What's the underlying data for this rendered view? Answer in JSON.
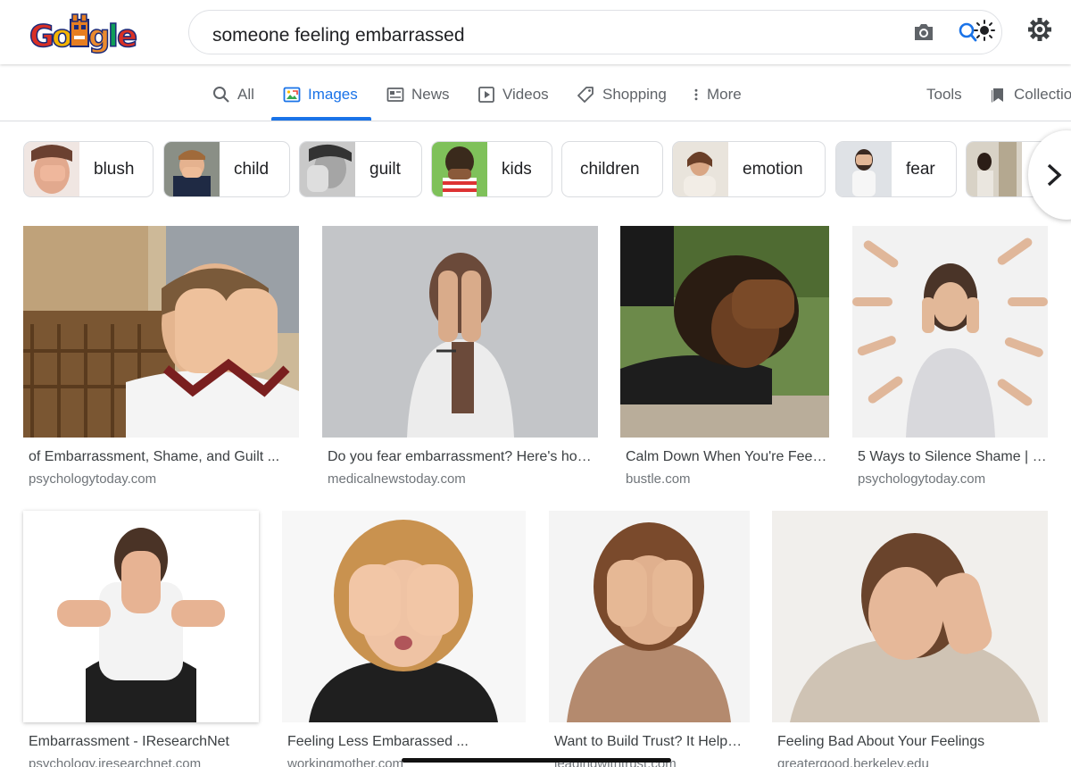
{
  "search": {
    "query": "someone feeling embarrassed"
  },
  "icons": {
    "logo": "google-doodle-logo",
    "camera": "camera-icon",
    "lens": "lens-search-icon",
    "settings": "gear-icon"
  },
  "tabs": [
    {
      "label": "All",
      "icon": "search-icon"
    },
    {
      "label": "Images",
      "icon": "image-icon",
      "active": true
    },
    {
      "label": "News",
      "icon": "news-icon"
    },
    {
      "label": "Videos",
      "icon": "video-icon"
    },
    {
      "label": "Shopping",
      "icon": "tag-icon"
    },
    {
      "label": "More",
      "icon": "dots-vertical-icon"
    }
  ],
  "tools": {
    "tools_label": "Tools",
    "collections_label": "Collections"
  },
  "chips": [
    {
      "label": "blush"
    },
    {
      "label": "child"
    },
    {
      "label": "guilt"
    },
    {
      "label": "kids"
    },
    {
      "label": "children"
    },
    {
      "label": "emotion"
    },
    {
      "label": "fear"
    }
  ],
  "results": [
    {
      "title": "of Embarrassment, Shame, and Guilt ...",
      "source": "psychologytoday.com"
    },
    {
      "title": "Do you fear embarrassment? Here's ho…",
      "source": "medicalnewstoday.com"
    },
    {
      "title": "Calm Down When You're Feel…",
      "source": "bustle.com"
    },
    {
      "title": "5 Ways to Silence Shame | …",
      "source": "psychologytoday.com"
    },
    {
      "title": "Embarrassment - IResearchNet",
      "source": "psychology.iresearchnet.com"
    },
    {
      "title": "Feeling Less Embarassed ...",
      "source": "workingmother.com"
    },
    {
      "title": "Want to Build Trust? It Help…",
      "source": "leadingwithtrust.com"
    },
    {
      "title": "Feeling Bad About Your Feelings",
      "source": "greatergood.berkeley.edu"
    }
  ],
  "colors": {
    "accent": "#1a73e8",
    "text": "#202124",
    "muted": "#70757a"
  }
}
